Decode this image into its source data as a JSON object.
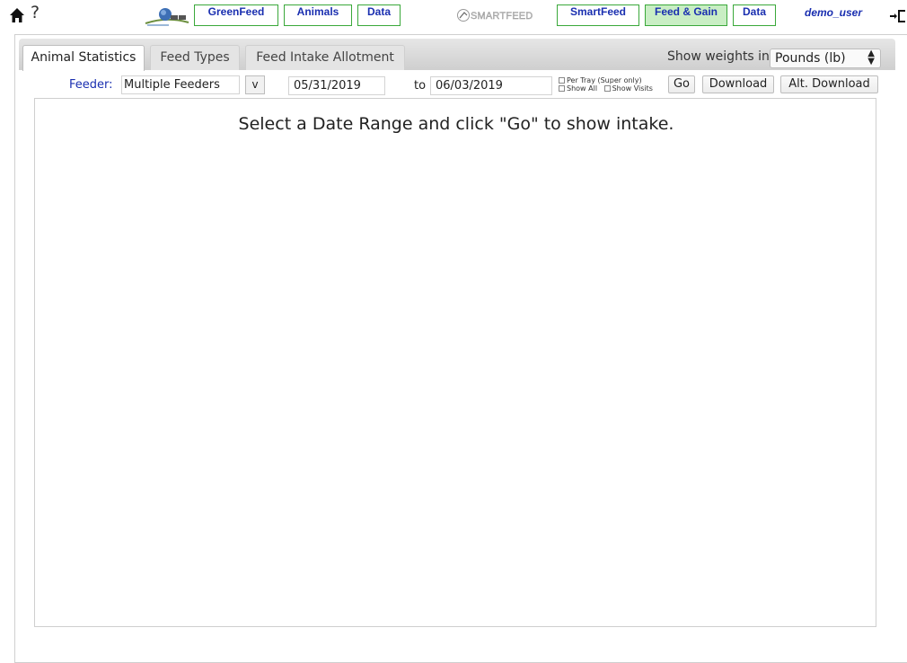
{
  "nav": {
    "help_label": "?",
    "items": [
      {
        "label": "GreenFeed"
      },
      {
        "label": "Animals"
      },
      {
        "label": "Data"
      },
      {
        "label": "SmartFeed"
      },
      {
        "label": "Feed & Gain"
      },
      {
        "label": "Data"
      }
    ],
    "user": "demo_user",
    "logos": {
      "left": "greenfeed-logo",
      "right": "smartfeed-logo"
    },
    "accent_border": "#3aa83a",
    "active_fill": "#c9eec4",
    "link_color": "#1a2fb0"
  },
  "tabs": [
    {
      "label": "Animal Statistics",
      "active": true
    },
    {
      "label": "Feed Types",
      "active": false
    },
    {
      "label": "Feed Intake Allotment",
      "active": false
    }
  ],
  "weights": {
    "label": "Show weights in",
    "selected": "Pounds (lb)"
  },
  "controls": {
    "feeder_label": "Feeder:",
    "feeder_value": "Multiple Feeders",
    "feeder_toggle": "v",
    "start_date": "05/31/2019",
    "to_label": "to",
    "end_date": "06/03/2019",
    "per_tray_label": "Per Tray (Super only)",
    "show_all_label": "Show All",
    "show_visits_label": "Show Visits",
    "go_label": "Go",
    "download_label": "Download",
    "alt_download_label": "Alt. Download"
  },
  "content": {
    "message": "Select a Date Range and click \"Go\" to show intake."
  }
}
